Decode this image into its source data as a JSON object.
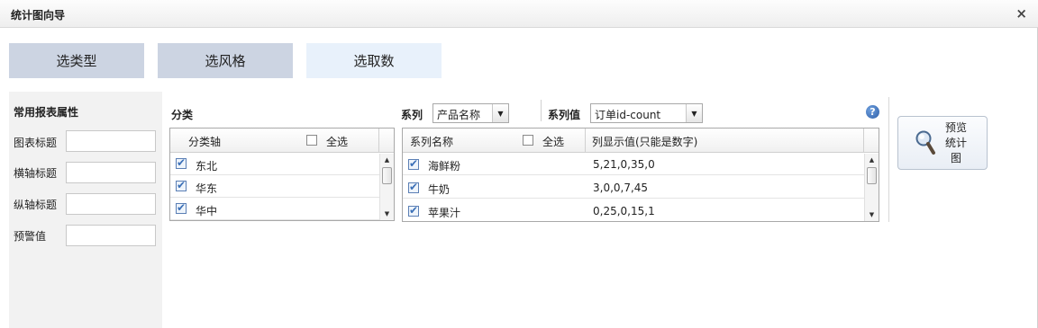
{
  "window": {
    "title": "统计图向导",
    "close_glyph": "×"
  },
  "steps": [
    {
      "label": "选类型",
      "state": "done"
    },
    {
      "label": "选风格",
      "state": "done"
    },
    {
      "label": "选取数",
      "state": "active"
    }
  ],
  "properties": {
    "heading": "常用报表属性",
    "fields": [
      {
        "label": "图表标题",
        "value": ""
      },
      {
        "label": "横轴标题",
        "value": ""
      },
      {
        "label": "纵轴标题",
        "value": ""
      },
      {
        "label": "预警值",
        "value": ""
      }
    ]
  },
  "category": {
    "label": "分类",
    "header": {
      "axis": "分类轴",
      "select_all": "全选",
      "select_all_checked": false
    },
    "items": [
      {
        "name": "东北",
        "checked": true
      },
      {
        "name": "华东",
        "checked": true
      },
      {
        "name": "华中",
        "checked": true
      }
    ]
  },
  "series": {
    "label": "系列",
    "selected": "产品名称",
    "value_label": "系列值",
    "value_selected": "订单id-count",
    "header": {
      "name": "系列名称",
      "select_all": "全选",
      "select_all_checked": false,
      "values_col": "列显示值(只能是数字)"
    },
    "rows": [
      {
        "name": "海鲜粉",
        "values": "5,21,0,35,0",
        "checked": true
      },
      {
        "name": "牛奶",
        "values": "3,0,0,7,45",
        "checked": true
      },
      {
        "name": "苹果汁",
        "values": "0,25,0,15,1",
        "checked": true
      }
    ]
  },
  "help_glyph": "?",
  "preview_button": {
    "label": "预览统计图",
    "line1": "预览",
    "line2": "统计",
    "line3": "图",
    "icon": "magnifier-icon"
  },
  "colors": {
    "step_done": "#ccd4e2",
    "step_active": "#e8f1fb",
    "check": "#3a6fb7",
    "help": "#2f5fa8"
  }
}
